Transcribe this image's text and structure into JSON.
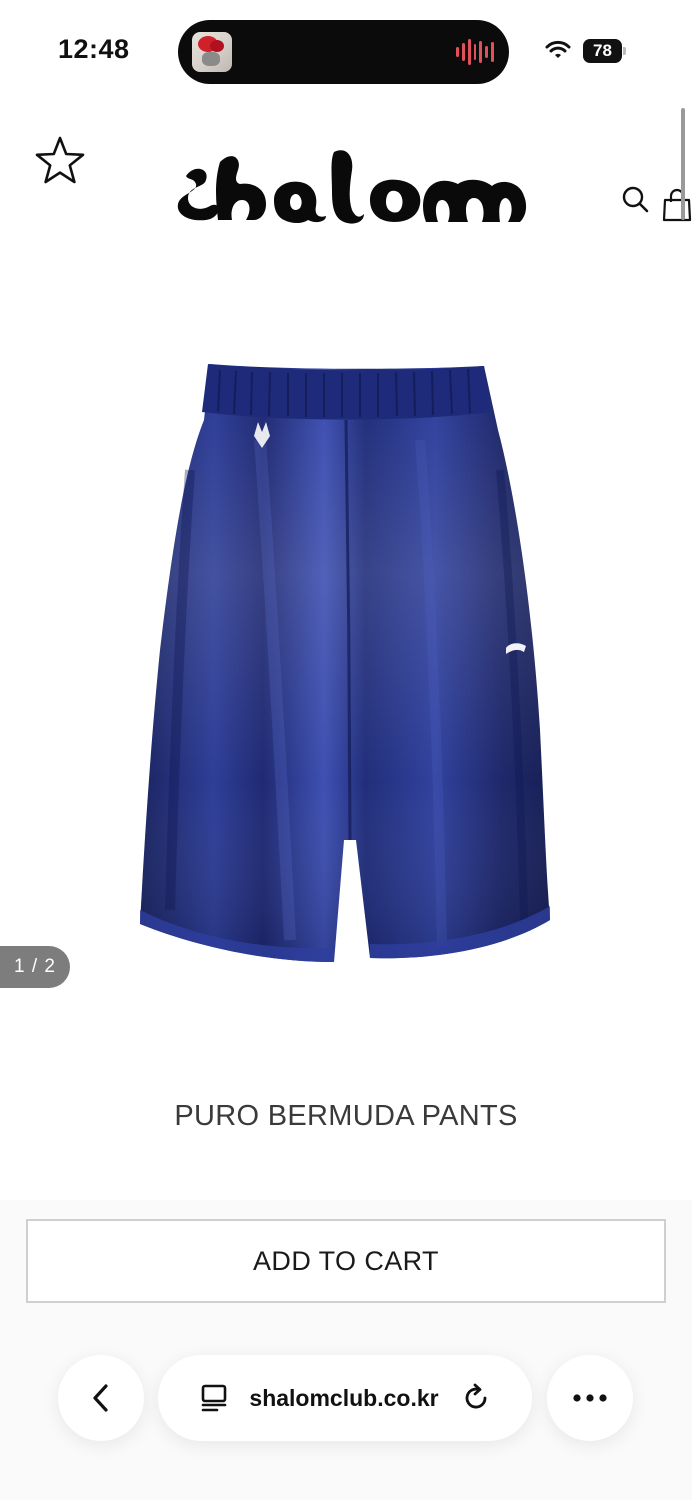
{
  "status_bar": {
    "time": "12:48",
    "battery": "78",
    "icons": [
      "now-playing-art",
      "audio-waveform-icon",
      "wifi-icon",
      "battery-icon"
    ]
  },
  "header": {
    "logo_text": "shalom",
    "icons": [
      "star-icon",
      "search-icon",
      "shopping-bag-icon"
    ]
  },
  "product": {
    "image_counter": "1 / 2",
    "title": "PURO BERMUDA PANTS",
    "colors": {
      "fabric": "#1f2f7a"
    }
  },
  "actions": {
    "add_to_cart": "ADD TO CART"
  },
  "browser": {
    "url": "shalomclub.co.kr",
    "icons": [
      "back-chevron-icon",
      "tabs-icon",
      "reload-icon",
      "more-dots-icon"
    ]
  }
}
